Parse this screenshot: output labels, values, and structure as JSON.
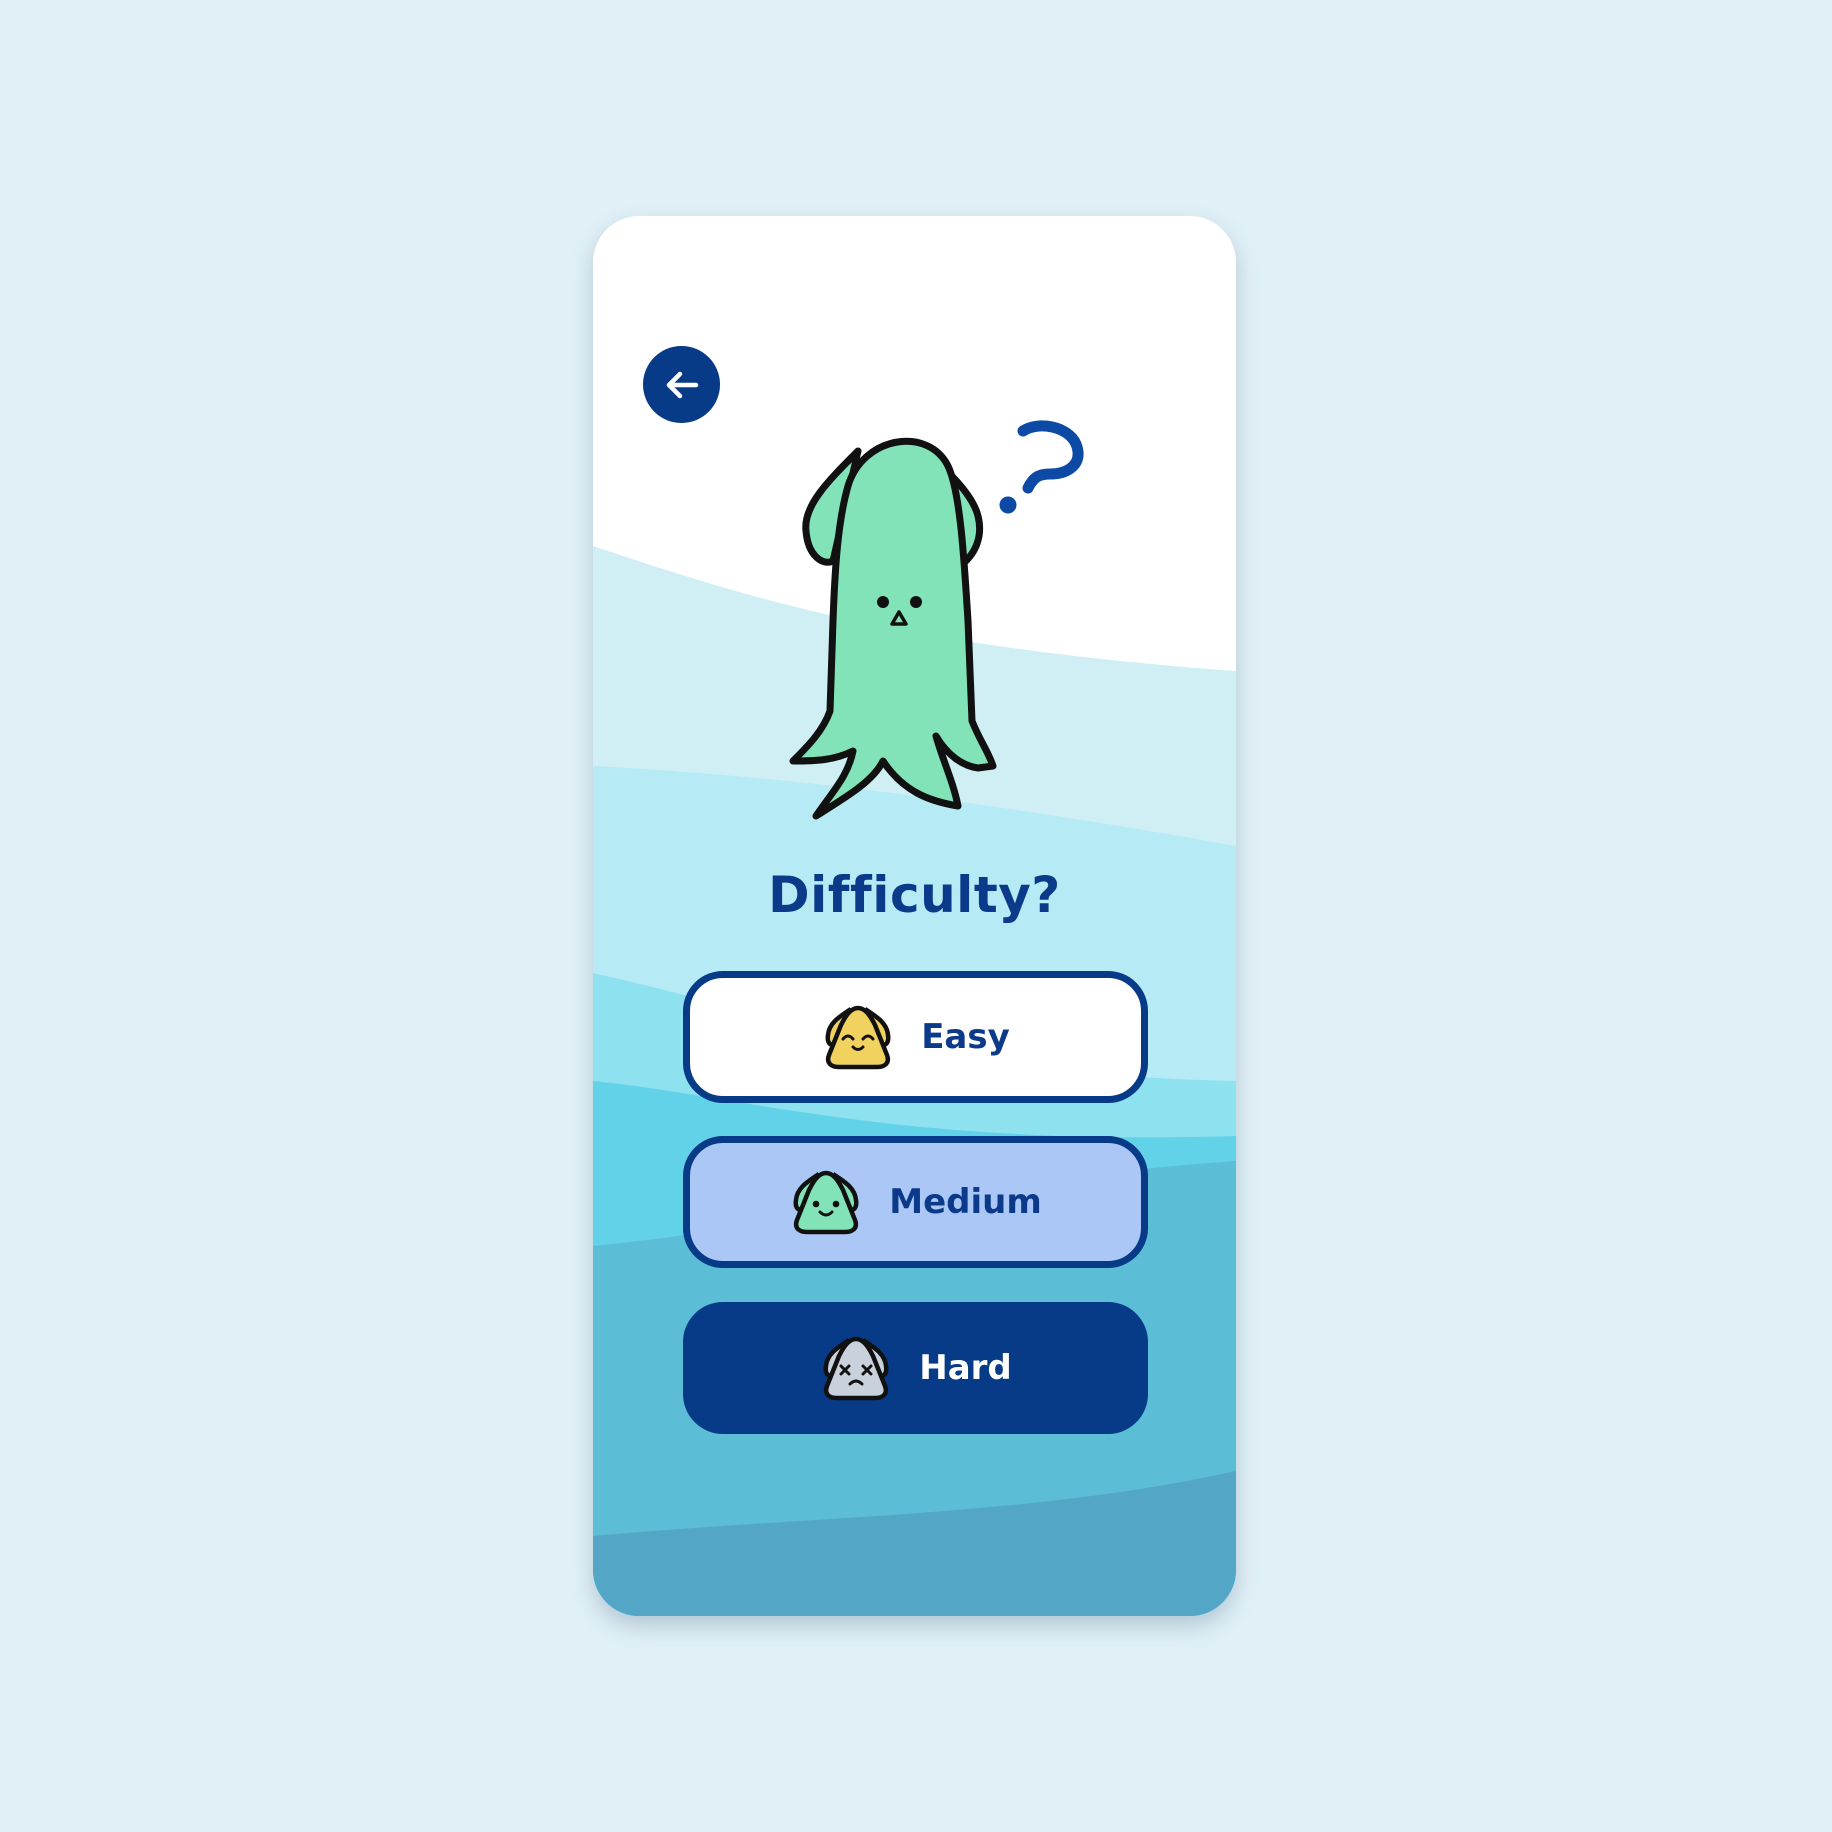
{
  "screen": {
    "title": "Difficulty?",
    "back_button": {
      "icon": "arrow-left-icon"
    },
    "mascot": {
      "icon": "squid-mascot",
      "thought_icon": "question-mark-icon"
    }
  },
  "options": [
    {
      "id": "easy",
      "label": "Easy",
      "icon": "happy-onigiri-face-icon",
      "face_color": "#f1d25f",
      "selected": false
    },
    {
      "id": "medium",
      "label": "Medium",
      "icon": "smile-onigiri-face-icon",
      "face_color": "#82e3b8",
      "selected": false
    },
    {
      "id": "hard",
      "label": "Hard",
      "icon": "dizzy-onigiri-face-icon",
      "face_color": "#c9d2dc",
      "selected": true
    }
  ],
  "colors": {
    "page_background": "#e1f0f7",
    "primary_navy": "#073a87",
    "title_text": "#0c3a8a",
    "mascot_green": "#82e3b8",
    "medium_button": "#abc7f6"
  }
}
